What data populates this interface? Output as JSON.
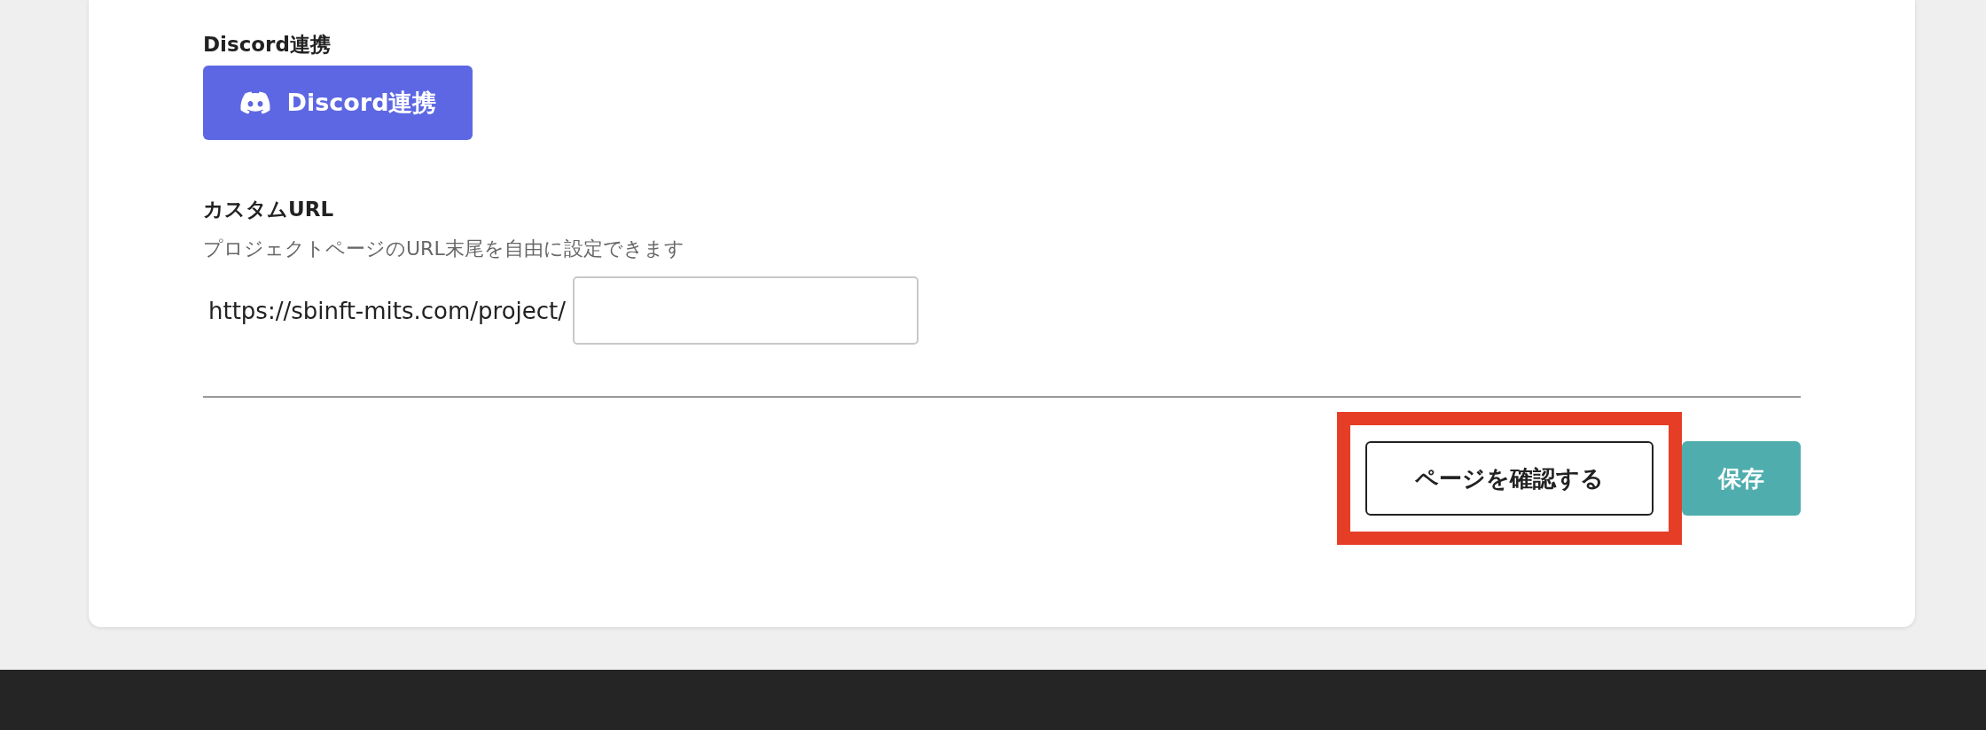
{
  "discord": {
    "label": "Discord連携",
    "button": "Discord連携"
  },
  "custom_url": {
    "label": "カスタムURL",
    "description": "プロジェクトページのURL末尾を自由に設定できます",
    "prefix": "https://sbinft-mits.com/project/"
  },
  "actions": [
    {
      "label": "ページを確認する",
      "kind": "outline",
      "highlighted": true
    },
    {
      "label": "保存",
      "kind": "primary",
      "highlighted": false
    }
  ]
}
